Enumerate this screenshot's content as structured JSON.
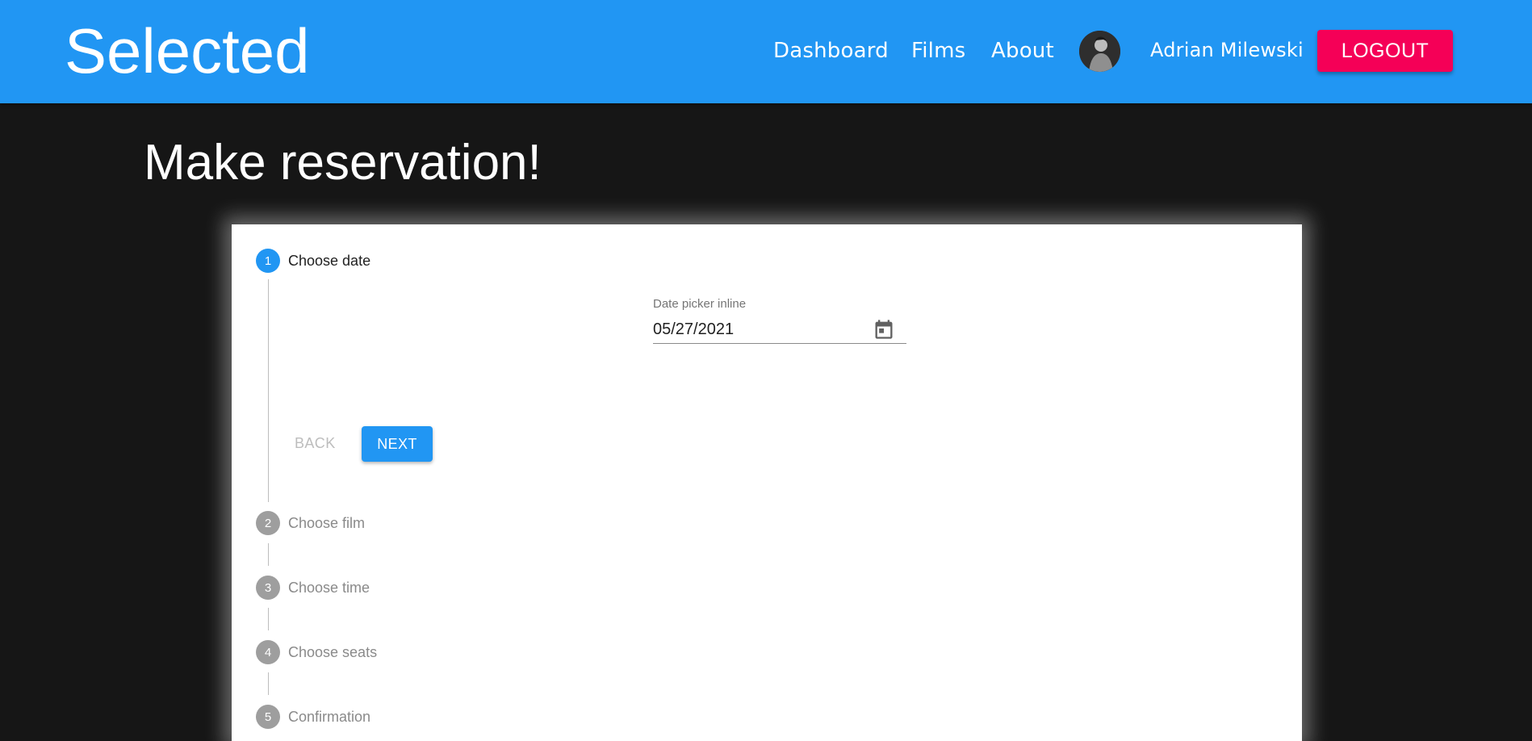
{
  "header": {
    "brand": "Selected",
    "nav": {
      "dashboard": "Dashboard",
      "films": "Films",
      "about": "About"
    },
    "user_name": "Adrian Milewski",
    "logout_label": "LOGOUT",
    "colors": {
      "appbar": "#2196f3",
      "logout": "#f50057"
    }
  },
  "main": {
    "title": "Make reservation!",
    "stepper": {
      "steps": [
        {
          "number": "1",
          "label": "Choose date",
          "active": true
        },
        {
          "number": "2",
          "label": "Choose film",
          "active": false
        },
        {
          "number": "3",
          "label": "Choose time",
          "active": false
        },
        {
          "number": "4",
          "label": "Choose seats",
          "active": false
        },
        {
          "number": "5",
          "label": "Confirmation",
          "active": false
        }
      ],
      "date_field": {
        "label": "Date picker inline",
        "value": "05/27/2021",
        "icon": "calendar-icon"
      },
      "back_label": "BACK",
      "next_label": "NEXT"
    }
  }
}
